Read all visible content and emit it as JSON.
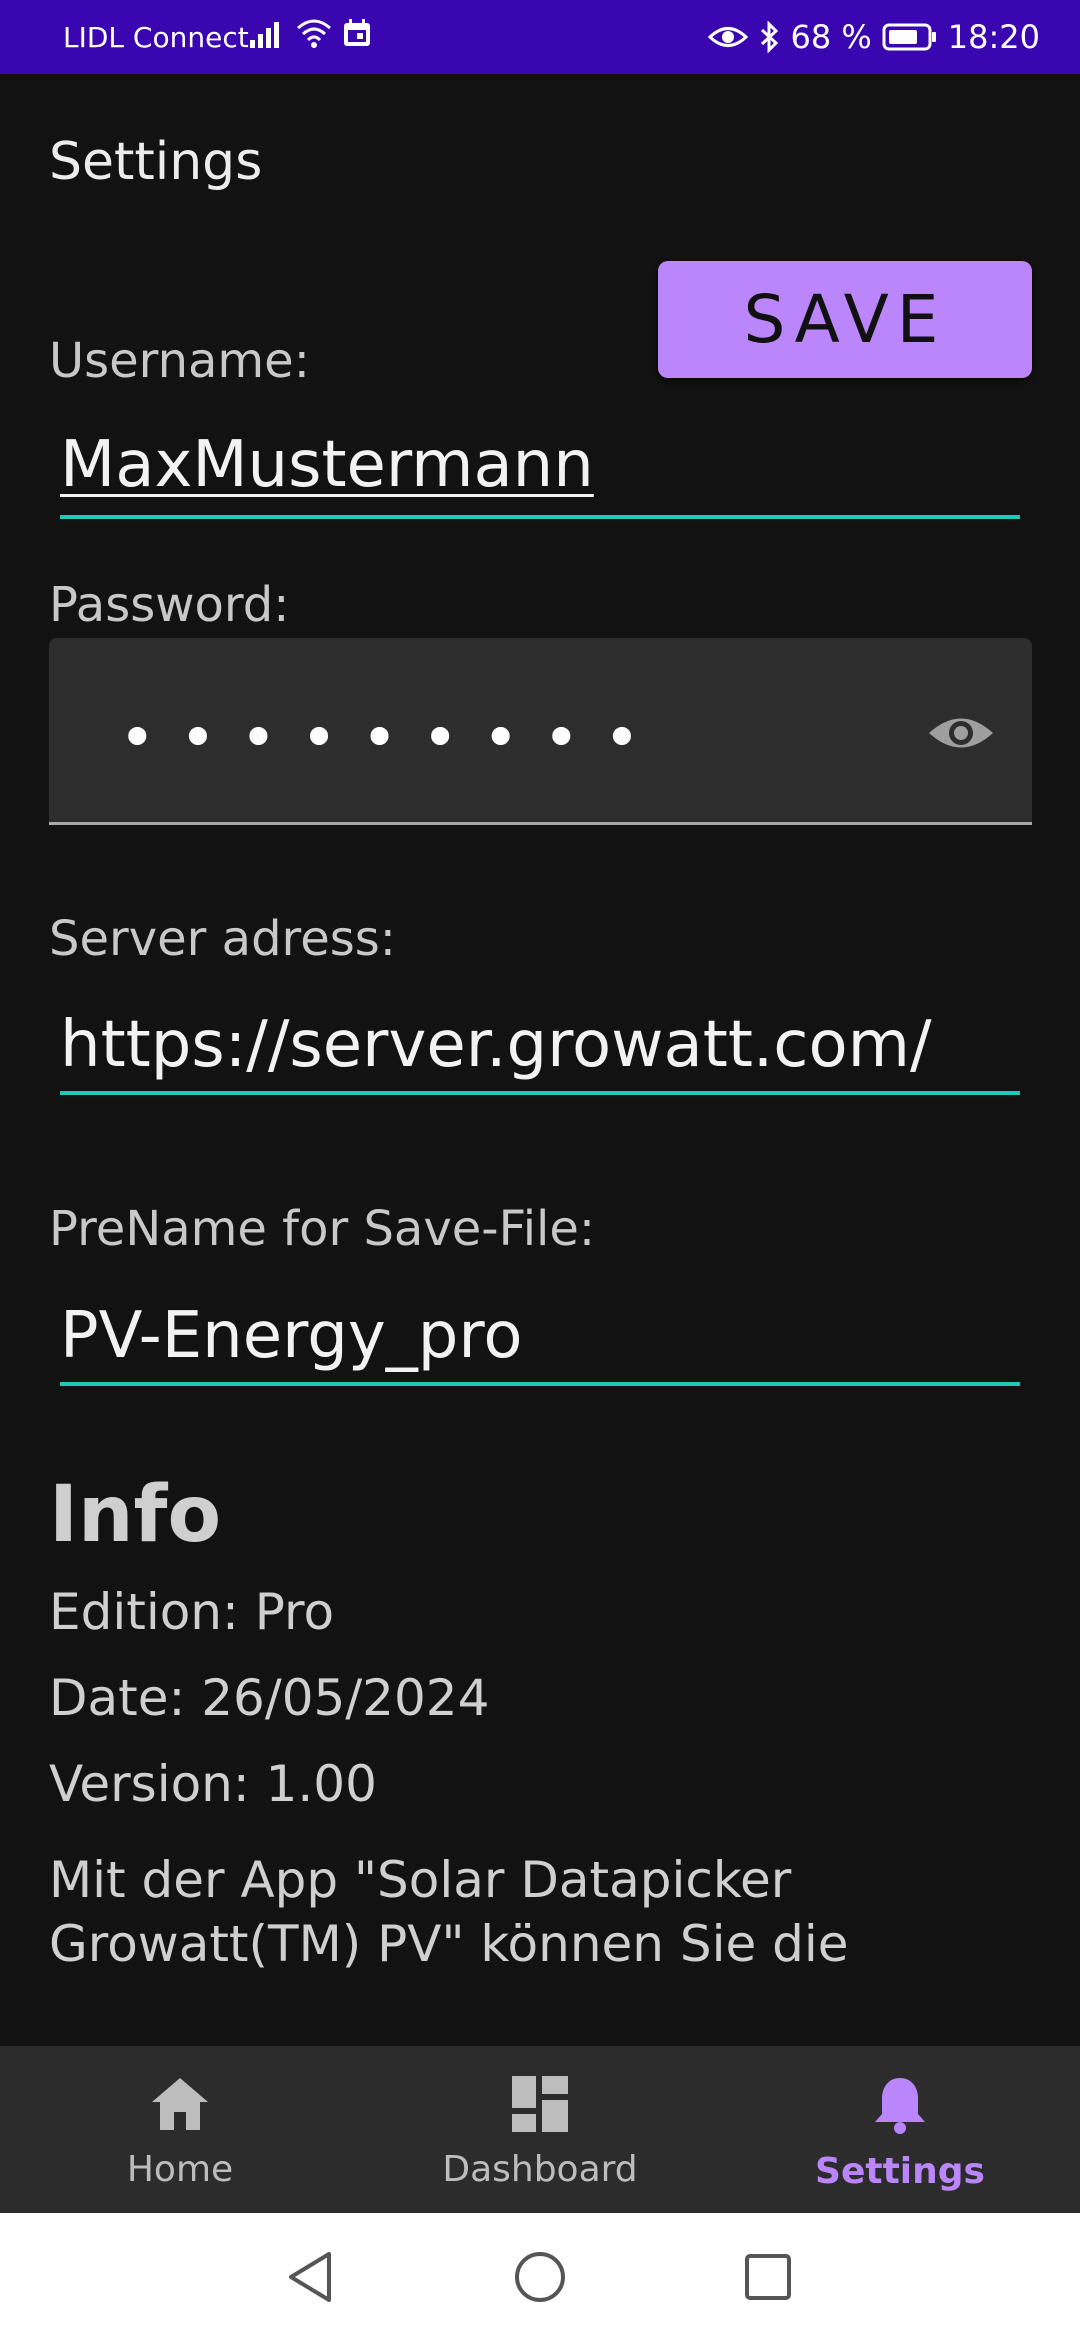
{
  "status_bar": {
    "carrier": "LIDL Connect",
    "battery_percent": "68 %",
    "time": "18:20",
    "icons": [
      "signal-icon",
      "wifi-icon",
      "calendar-icon",
      "eye-icon",
      "bluetooth-icon",
      "battery-icon"
    ]
  },
  "header": {
    "title": "Settings"
  },
  "toolbar": {
    "save_label": "SAVE"
  },
  "form": {
    "username_label": "Username:",
    "username_value": "MaxMustermann",
    "password_label": "Password:",
    "password_mask": "•••••••••",
    "server_label": "Server adress:",
    "server_value": "https://server.growatt.com/",
    "prename_label": "PreName for Save-File:",
    "prename_value": "PV-Energy_pro"
  },
  "info": {
    "heading": "Info",
    "edition": "Edition:  Pro",
    "date": "Date: 26/05/2024",
    "version": "Version: 1.00",
    "description": "Mit der App \"Solar Datapicker Growatt(TM) PV\" können Sie die"
  },
  "bottom_nav": {
    "items": [
      {
        "label": "Home",
        "icon": "home-icon"
      },
      {
        "label": "Dashboard",
        "icon": "dashboard-icon"
      },
      {
        "label": "Settings",
        "icon": "bell-icon"
      }
    ],
    "active_index": 2
  },
  "colors": {
    "status_bar": "#3a06b0",
    "background": "#121212",
    "accent": "#bb86fc",
    "field_underline": "#1ec9b7"
  }
}
